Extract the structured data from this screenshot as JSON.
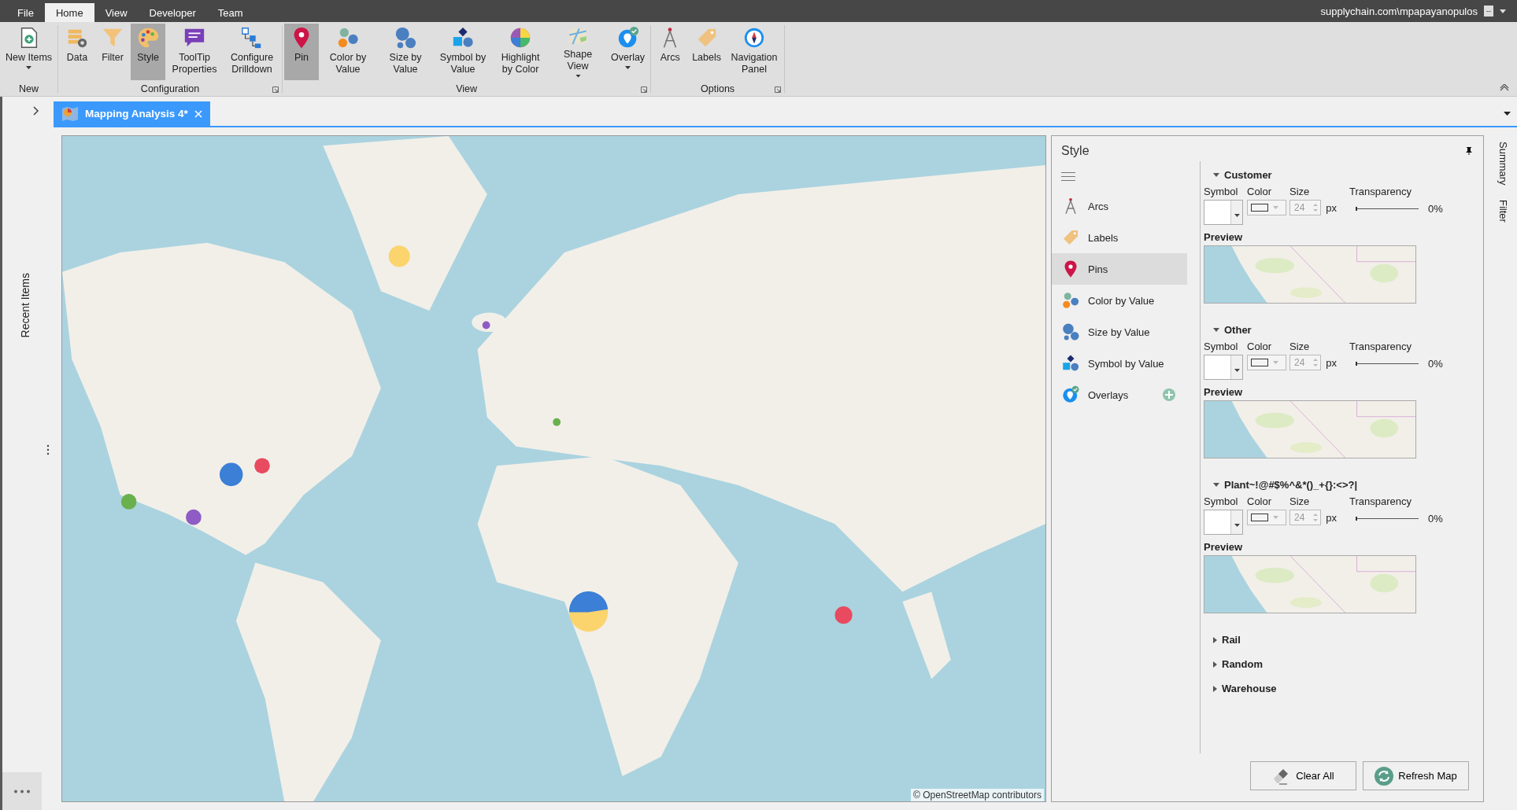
{
  "menu_tabs": [
    {
      "label": "File",
      "selected": false
    },
    {
      "label": "Home",
      "selected": true
    },
    {
      "label": "View",
      "selected": false
    },
    {
      "label": "Developer",
      "selected": false
    },
    {
      "label": "Team",
      "selected": false
    }
  ],
  "account": {
    "user": "supplychain.com\\mpapayanopulos",
    "box": "--"
  },
  "ribbon_groups": [
    {
      "name": "New",
      "launcher": false,
      "buttons": [
        {
          "label": "New Items",
          "kind": "new",
          "dropdown": true,
          "selected": false
        }
      ]
    },
    {
      "name": "Configuration",
      "launcher": true,
      "buttons": [
        {
          "label": "Data",
          "kind": "data",
          "dropdown": false,
          "selected": false
        },
        {
          "label": "Filter",
          "kind": "filter",
          "dropdown": false,
          "selected": false
        },
        {
          "label": "Style",
          "kind": "style",
          "dropdown": false,
          "selected": true
        },
        {
          "label": "ToolTip Properties",
          "kind": "tooltip",
          "dropdown": false,
          "selected": false
        },
        {
          "label": "Configure Drilldown",
          "kind": "drilldown",
          "dropdown": false,
          "selected": false
        }
      ]
    },
    {
      "name": "View",
      "launcher": true,
      "buttons": [
        {
          "label": "Pin",
          "kind": "pin",
          "dropdown": false,
          "selected": true
        },
        {
          "label": "Color by Value",
          "kind": "color_value",
          "dropdown": false,
          "selected": false
        },
        {
          "label": "Size by Value",
          "kind": "size_value",
          "dropdown": false,
          "selected": false
        },
        {
          "label": "Symbol by Value",
          "kind": "symbol_value",
          "dropdown": false,
          "selected": false
        },
        {
          "label": "Highlight by Color",
          "kind": "highlight",
          "dropdown": false,
          "selected": false
        },
        {
          "label": "Shape View",
          "kind": "shape_view",
          "dropdown": true,
          "selected": false
        },
        {
          "label": "Overlay",
          "kind": "overlay",
          "dropdown": true,
          "selected": false
        }
      ]
    },
    {
      "name": "Options",
      "launcher": true,
      "buttons": [
        {
          "label": "Arcs",
          "kind": "arcs",
          "dropdown": false,
          "selected": false
        },
        {
          "label": "Labels",
          "kind": "labels",
          "dropdown": false,
          "selected": false
        },
        {
          "label": "Navigation Panel",
          "kind": "navigation",
          "dropdown": false,
          "selected": false
        }
      ]
    }
  ],
  "document_tab": {
    "title": "Mapping Analysis 4*"
  },
  "left_panel": {
    "title": "Recent Items"
  },
  "map": {
    "attribution": "© OpenStreetMap contributors"
  },
  "style_panel": {
    "title": "Style",
    "nav": [
      {
        "label": "Arcs",
        "kind": "arcs",
        "selected": false,
        "addable": false
      },
      {
        "label": "Labels",
        "kind": "labels",
        "selected": false,
        "addable": false
      },
      {
        "label": "Pins",
        "kind": "pin",
        "selected": true,
        "addable": false
      },
      {
        "label": "Color by Value",
        "kind": "color_value",
        "selected": false,
        "addable": false
      },
      {
        "label": "Size by Value",
        "kind": "size_value",
        "selected": false,
        "addable": false
      },
      {
        "label": "Symbol by Value",
        "kind": "symbol_value",
        "selected": false,
        "addable": false
      },
      {
        "label": "Overlays",
        "kind": "overlay",
        "selected": false,
        "addable": true
      }
    ],
    "sections": [
      {
        "name": "Customer",
        "expanded": true,
        "symbol_label": "Symbol",
        "color_label": "Color",
        "size_label": "Size",
        "transparency_label": "Transparency",
        "size": "24",
        "unit": "px",
        "level": 0,
        "transparency": "0%",
        "preview_label": "Preview"
      },
      {
        "name": "Other",
        "expanded": true,
        "symbol_label": "Symbol",
        "color_label": "Color",
        "size_label": "Size",
        "transparency_label": "Transparency",
        "size": "24",
        "unit": "px",
        "level": 0,
        "transparency": "0%",
        "preview_label": "Preview"
      },
      {
        "name": "Plant~!@#$%^&*()_+{}:<>?|",
        "expanded": true,
        "symbol_label": "Symbol",
        "color_label": "Color",
        "size_label": "Size",
        "transparency_label": "Transparency",
        "size": "24",
        "unit": "px",
        "level": 0,
        "transparency": "0%",
        "preview_label": "Preview"
      },
      {
        "name": "Rail",
        "expanded": false
      },
      {
        "name": "Random",
        "expanded": false
      },
      {
        "name": "Warehouse",
        "expanded": false
      }
    ],
    "buttons": [
      {
        "label": "Clear All",
        "kind": "clear"
      },
      {
        "label": "Refresh Map",
        "kind": "refresh"
      }
    ]
  },
  "side_tabs": [
    {
      "label": "Summary"
    },
    {
      "label": "Filter"
    }
  ]
}
